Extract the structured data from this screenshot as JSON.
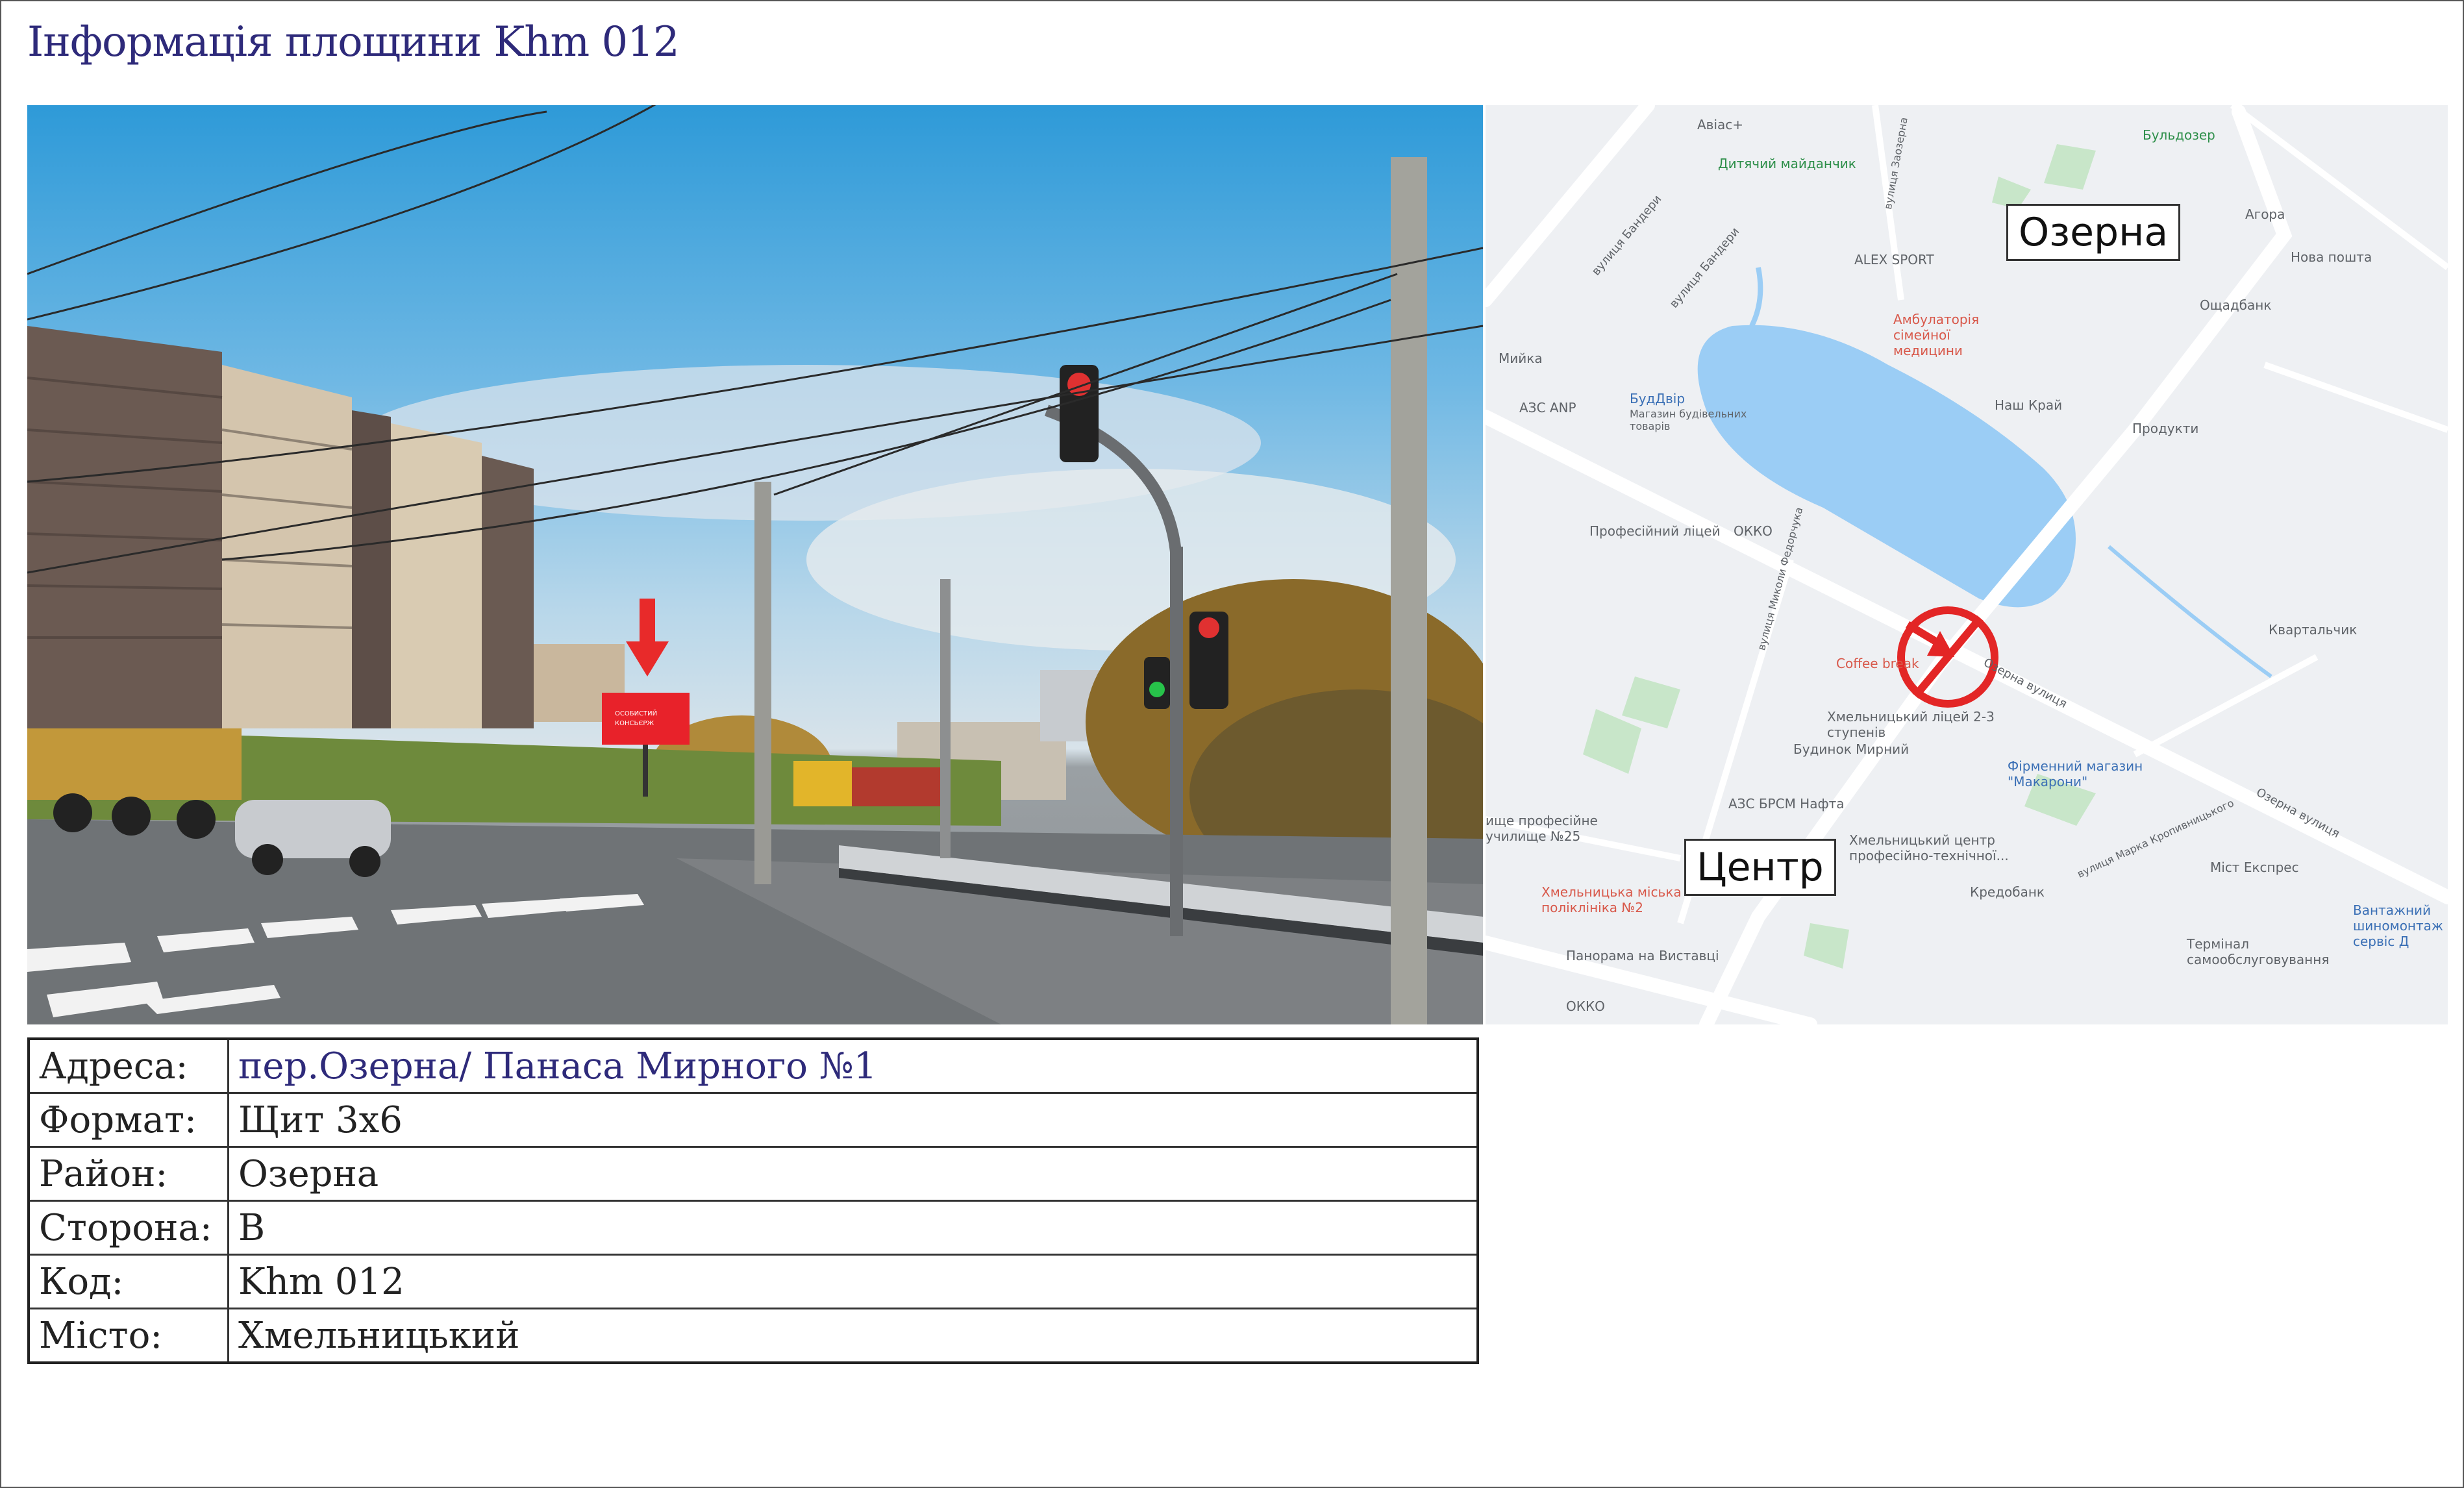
{
  "title": "Інформація площини Khm 012",
  "map": {
    "districts": [
      "Озерна",
      "Центр"
    ],
    "pois": [
      {
        "label": "Авіас+",
        "tone": "gray"
      },
      {
        "label": "Бульдозер",
        "tone": "green"
      },
      {
        "label": "Дитячий майданчик",
        "tone": "green"
      },
      {
        "label": "Агора",
        "tone": "gray"
      },
      {
        "label": "Нова пошта",
        "tone": "gray"
      },
      {
        "label": "ALEX SPORT",
        "tone": "gray"
      },
      {
        "label": "Ощадбанк",
        "tone": "gray"
      },
      {
        "label": "Амбулаторія сімейної медицини",
        "tone": "red"
      },
      {
        "label": "Мийка",
        "tone": "gray"
      },
      {
        "label": "АЗС ANP",
        "tone": "gray"
      },
      {
        "label": "БудДвір",
        "tone": "blue"
      },
      {
        "label": "Магазин будівельних товарів",
        "tone": "gray"
      },
      {
        "label": "Наш Край",
        "tone": "gray"
      },
      {
        "label": "Продукти",
        "tone": "gray"
      },
      {
        "label": "Професійний ліцей",
        "tone": "gray"
      },
      {
        "label": "ОККО",
        "tone": "gray"
      },
      {
        "label": "Квартальчик",
        "tone": "gray"
      },
      {
        "label": "Coffee break",
        "tone": "red"
      },
      {
        "label": "Хмельницький ліцей 2-3 ступенів",
        "tone": "gray"
      },
      {
        "label": "Будинок Мирний",
        "tone": "gray"
      },
      {
        "label": "Фірменний магазин \"Макарони\"",
        "tone": "blue"
      },
      {
        "label": "АЗС БРСМ Нафта",
        "tone": "gray"
      },
      {
        "label": "Хмельницький центр професійно-технічної...",
        "tone": "gray"
      },
      {
        "label": "Кредобанк",
        "tone": "gray"
      },
      {
        "label": "Міст Експрес",
        "tone": "gray"
      },
      {
        "label": "Хмельницька міська поліклініка №2",
        "tone": "red"
      },
      {
        "label": "Панорама на Виставці",
        "tone": "gray"
      },
      {
        "label": "Термінал самообслуговування",
        "tone": "gray"
      },
      {
        "label": "Вантажний шиномонтаж сервіс Д",
        "tone": "blue"
      },
      {
        "label": "ОККО",
        "tone": "gray"
      },
      {
        "label": "ище професійне училище №25",
        "tone": "gray"
      }
    ],
    "streets": [
      "вулиця Бандери",
      "вулиця Бандери",
      "Озерна вулиця",
      "Озерна вулиця",
      "вулиця Миколи Федорчука",
      "вулиця Марка Кропивницького",
      "вулиця Заозерна"
    ]
  },
  "billboard_text": "ОСОБИСТИЙ КОНСЬЄРЖ",
  "info": [
    {
      "key": "Адреса:",
      "value": "пер.Озерна/ Панаса Мирного №1"
    },
    {
      "key": "Формат:",
      "value": "Щит 3х6"
    },
    {
      "key": "Район:",
      "value": "Озерна"
    },
    {
      "key": "Сторона:",
      "value": "В"
    },
    {
      "key": "Код:",
      "value": "Khm 012"
    },
    {
      "key": "Місто:",
      "value": "Хмельницький"
    }
  ]
}
